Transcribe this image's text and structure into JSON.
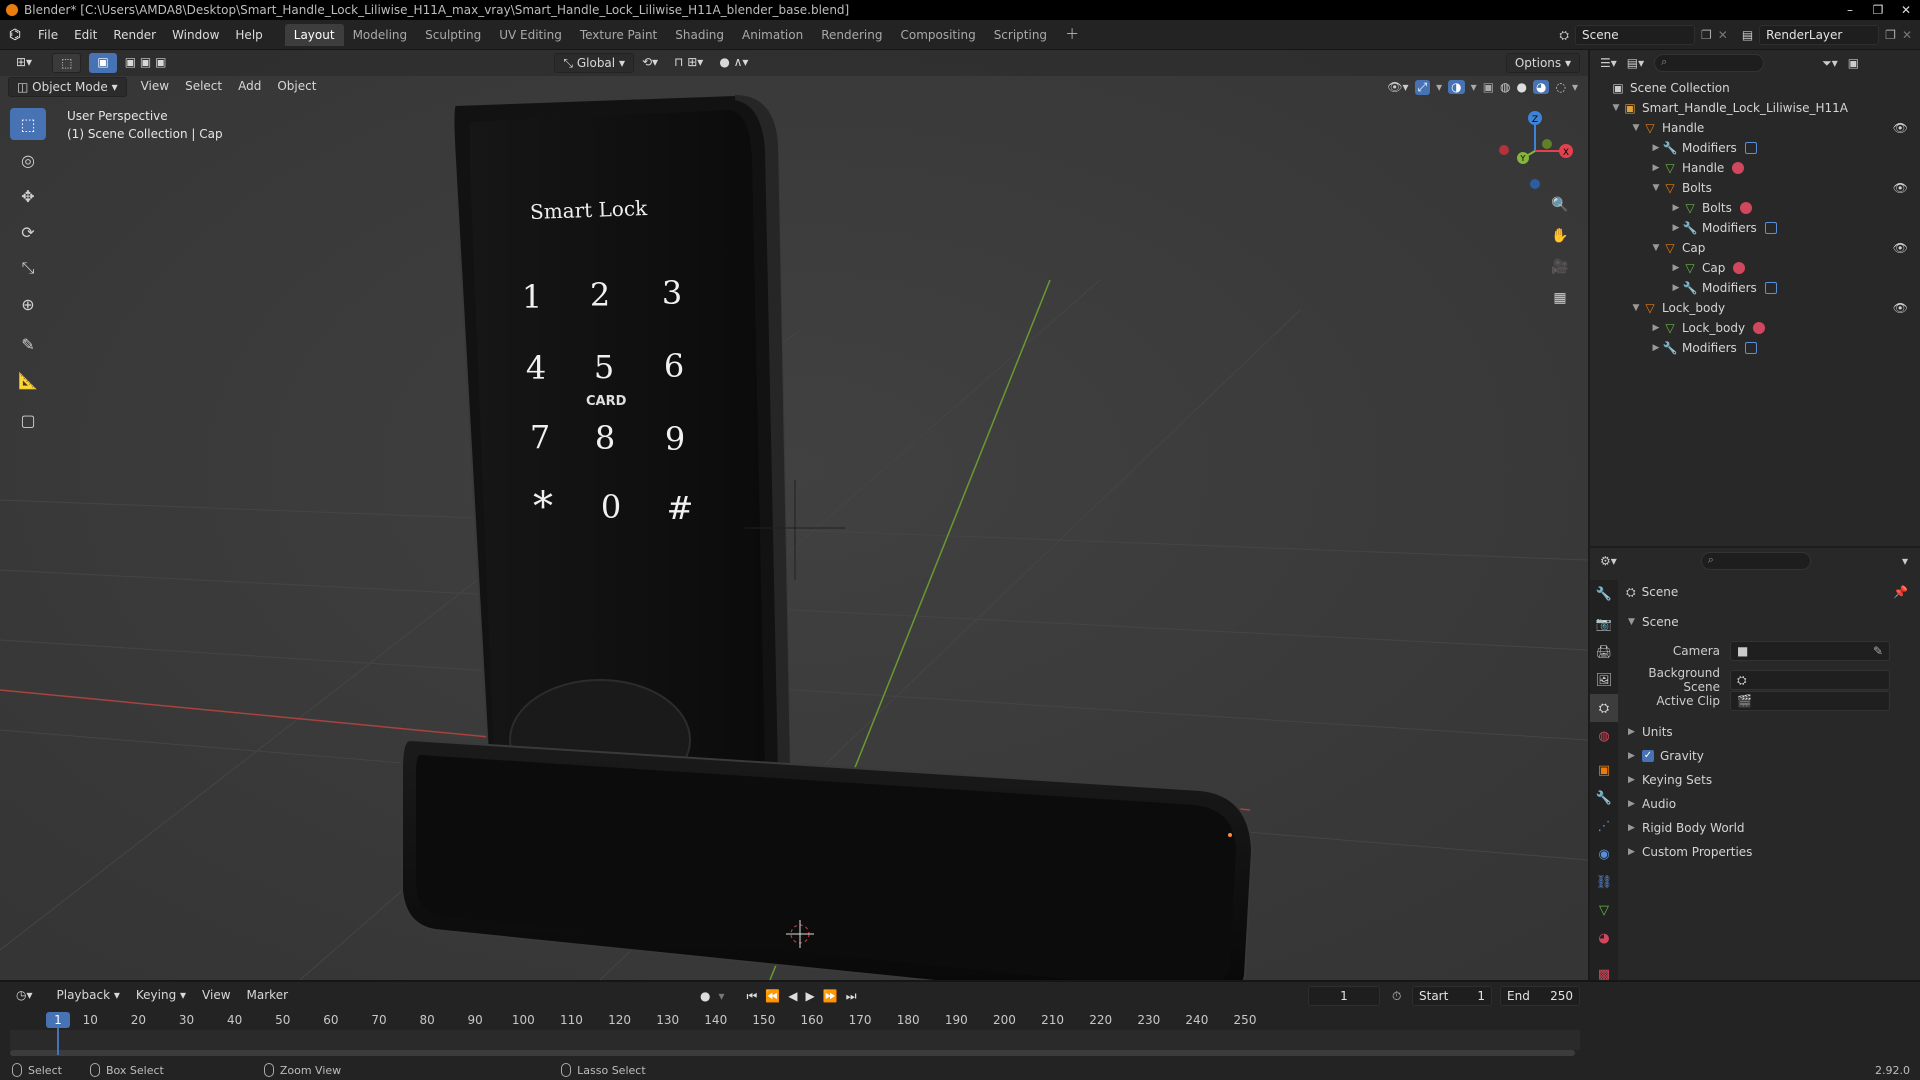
{
  "window": {
    "title": "Blender* [C:\\Users\\AMDA8\\Desktop\\Smart_Handle_Lock_Liliwise_H11A_max_vray\\Smart_Handle_Lock_Liliwise_H11A_blender_base.blend]",
    "controls": [
      "–",
      "❐",
      "✕"
    ]
  },
  "menu": [
    "File",
    "Edit",
    "Render",
    "Window",
    "Help"
  ],
  "workspaces": [
    "Layout",
    "Modeling",
    "Sculpting",
    "UV Editing",
    "Texture Paint",
    "Shading",
    "Animation",
    "Rendering",
    "Compositing",
    "Scripting"
  ],
  "active_workspace": "Layout",
  "scene_name": "Scene",
  "render_layer": "RenderLayer",
  "viewport": {
    "mode": "Object Mode",
    "menus": [
      "View",
      "Select",
      "Add",
      "Object"
    ],
    "transform_orientation": "Global",
    "options_label": "Options",
    "overlay_title": "User Perspective",
    "overlay_subtitle": "(1) Scene Collection | Cap",
    "gizmo_axes": {
      "x": "X",
      "y": "Y",
      "z": "Z"
    },
    "object": {
      "brand": "Smart Lock",
      "keypad": [
        "1",
        "2",
        "3",
        "4",
        "5",
        "6",
        "7",
        "8",
        "9",
        "*",
        "0",
        "#"
      ],
      "card_label": "CARD"
    }
  },
  "outliner": {
    "root": "Scene Collection",
    "items": [
      {
        "label": "Smart_Handle_Lock_Liliwise_H11A",
        "depth": 1,
        "type": "collection",
        "expanded": true,
        "eye": false
      },
      {
        "label": "Handle",
        "depth": 2,
        "type": "object",
        "expanded": true,
        "eye": true
      },
      {
        "label": "Modifiers",
        "depth": 3,
        "type": "modifiers",
        "expanded": false,
        "eye": false
      },
      {
        "label": "Handle",
        "depth": 3,
        "type": "mesh",
        "expanded": false,
        "eye": false
      },
      {
        "label": "Bolts",
        "depth": 3,
        "type": "object",
        "expanded": true,
        "eye": true
      },
      {
        "label": "Bolts",
        "depth": 4,
        "type": "mesh",
        "expanded": false,
        "eye": false
      },
      {
        "label": "Modifiers",
        "depth": 4,
        "type": "modifiers",
        "expanded": false,
        "eye": false
      },
      {
        "label": "Cap",
        "depth": 3,
        "type": "object",
        "expanded": true,
        "eye": true
      },
      {
        "label": "Cap",
        "depth": 4,
        "type": "mesh",
        "expanded": false,
        "eye": false
      },
      {
        "label": "Modifiers",
        "depth": 4,
        "type": "modifiers",
        "expanded": false,
        "eye": false
      },
      {
        "label": "Lock_body",
        "depth": 2,
        "type": "object",
        "expanded": true,
        "eye": true
      },
      {
        "label": "Lock_body",
        "depth": 3,
        "type": "mesh",
        "expanded": false,
        "eye": false
      },
      {
        "label": "Modifiers",
        "depth": 3,
        "type": "modifiers",
        "expanded": false,
        "eye": false
      }
    ]
  },
  "properties": {
    "context": "Scene",
    "panel_title": "Scene",
    "fields": [
      {
        "label": "Camera",
        "value": ""
      },
      {
        "label": "Background Scene",
        "value": ""
      },
      {
        "label": "Active Clip",
        "value": ""
      }
    ],
    "sections": [
      "Units",
      "Gravity",
      "Keying Sets",
      "Audio",
      "Rigid Body World",
      "Custom Properties"
    ],
    "gravity_checked": true
  },
  "timeline": {
    "menus": [
      "Playback",
      "Keying",
      "View",
      "Marker"
    ],
    "current_frame": "1",
    "start_label": "Start",
    "start": "1",
    "end_label": "End",
    "end": "250",
    "ruler": [
      "1",
      "10",
      "20",
      "30",
      "40",
      "50",
      "60",
      "70",
      "80",
      "90",
      "100",
      "110",
      "120",
      "130",
      "140",
      "150",
      "160",
      "170",
      "180",
      "190",
      "200",
      "210",
      "220",
      "230",
      "240",
      "250"
    ]
  },
  "status": {
    "select": "Select",
    "box_select": "Box Select",
    "zoom_view": "Zoom View",
    "lasso_select": "Lasso Select",
    "version": "2.92.0"
  },
  "colors": {
    "accent": "#4772b3",
    "object_orange": "#e87d0d",
    "mesh_green": "#69b544",
    "material_red": "#d1475d",
    "x_axis": "#e3414e",
    "y_axis": "#86b53c",
    "z_axis": "#3d83d8"
  }
}
